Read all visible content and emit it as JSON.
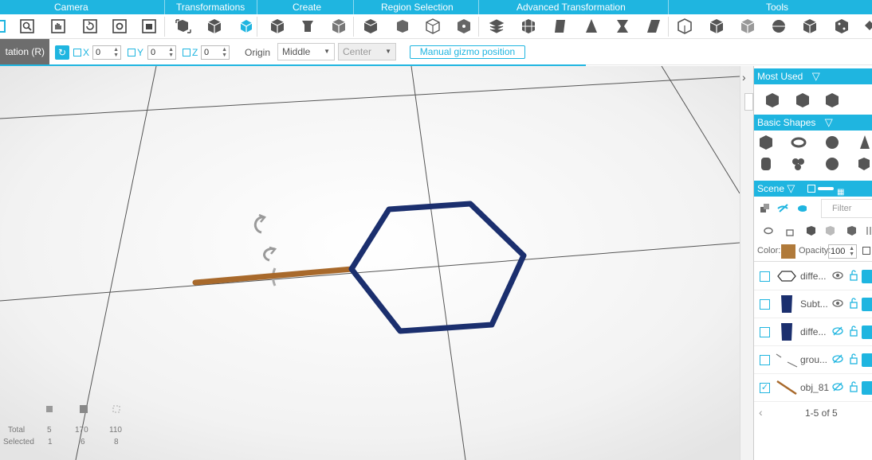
{
  "ribbon": {
    "categories": [
      "Camera",
      "Transformations",
      "Create",
      "Region Selection",
      "Advanced Transformation",
      "Tools"
    ]
  },
  "toolbar": {
    "mode_label": "tation (R)",
    "axis_x": "X",
    "axis_y": "Y",
    "axis_z": "Z",
    "x_value": "0",
    "y_value": "0",
    "z_value": "0",
    "origin_label": "Origin",
    "origin_select": "Middle",
    "center_select": "Center",
    "manual_gizmo": "Manual gizmo position"
  },
  "stats": {
    "total_label": "Total",
    "selected_label": "Selected",
    "total": [
      "5",
      "170",
      "110"
    ],
    "selected": [
      "1",
      "6",
      "8"
    ]
  },
  "panel": {
    "most_used": "Most Used",
    "basic_shapes": "Basic Shapes",
    "scene": "Scene",
    "filter": "Filter",
    "color_label": "Color:",
    "opacity_label": "Opacity:",
    "opacity_value": "100",
    "pagination": "1-5 of 5",
    "objects": [
      {
        "name": "diffe...",
        "checked": false
      },
      {
        "name": "Subt...",
        "checked": false
      },
      {
        "name": "diffe...",
        "checked": false
      },
      {
        "name": "grou...",
        "checked": false
      },
      {
        "name": "obj_81",
        "checked": true
      }
    ]
  },
  "colors": {
    "accent": "#1fb5e0",
    "hexagon": "#1b2f6e",
    "rod": "#a8692b",
    "object_color": "#b07a3a"
  }
}
